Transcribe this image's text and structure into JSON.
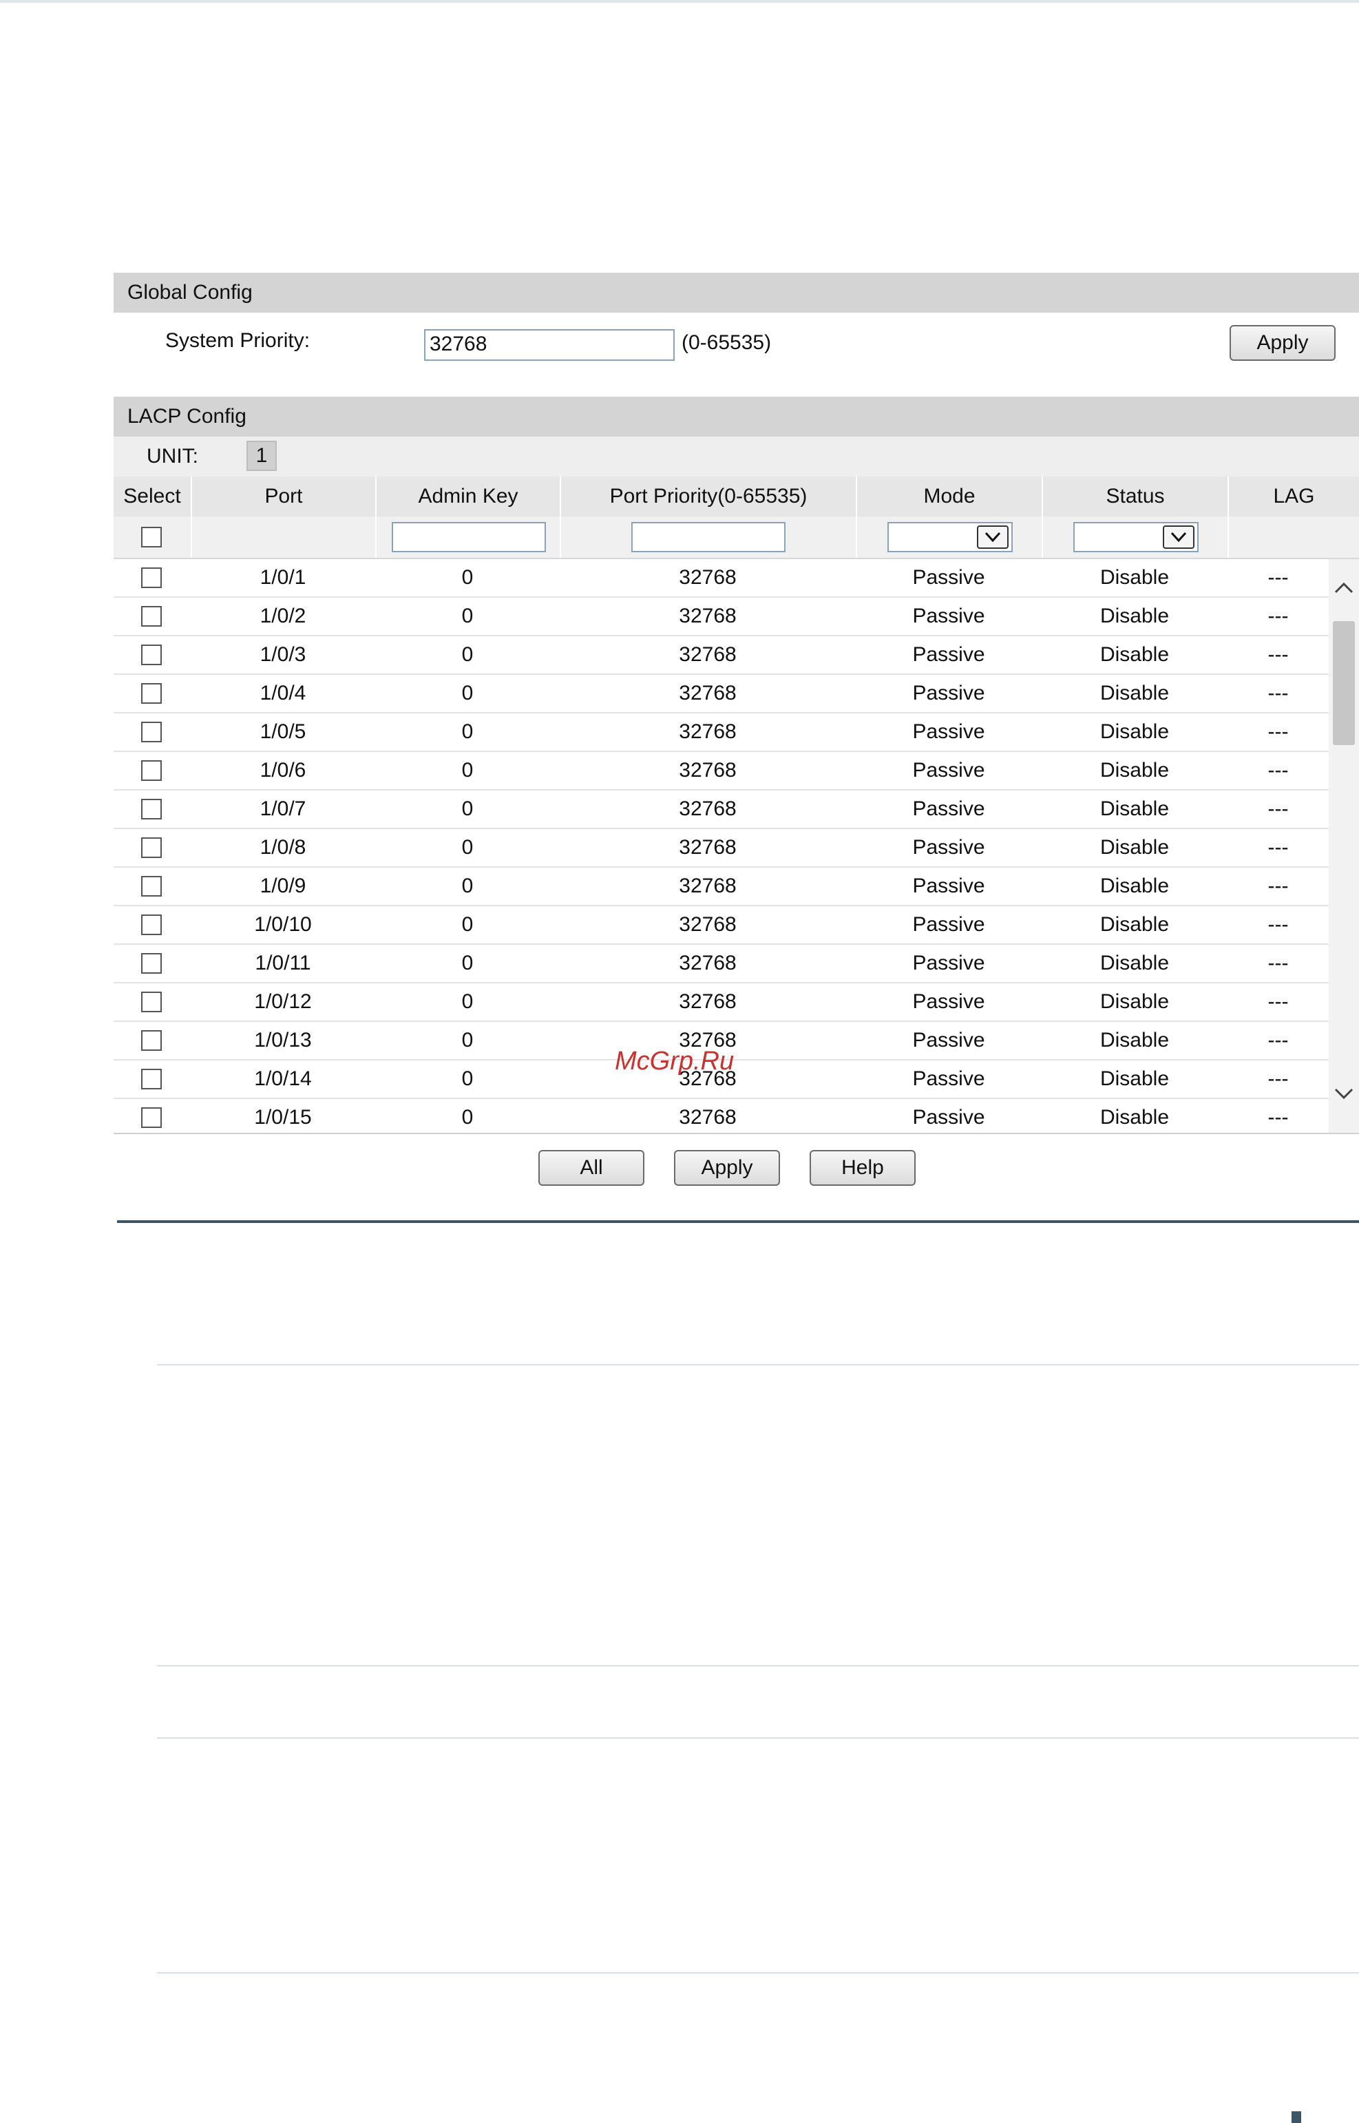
{
  "global_config": {
    "title": "Global Config",
    "system_priority_label": "System Priority:",
    "system_priority_value": "32768",
    "range_hint": "(0-65535)",
    "apply_label": "Apply"
  },
  "lacp_config": {
    "title": "LACP Config",
    "unit_label": "UNIT:",
    "unit_value": "1",
    "columns": [
      "Select",
      "Port",
      "Admin Key",
      "Port Priority(0-65535)",
      "Mode",
      "Status",
      "LAG"
    ],
    "rows": [
      {
        "port": "1/0/1",
        "admin_key": "0",
        "priority": "32768",
        "mode": "Passive",
        "status": "Disable",
        "lag": "---"
      },
      {
        "port": "1/0/2",
        "admin_key": "0",
        "priority": "32768",
        "mode": "Passive",
        "status": "Disable",
        "lag": "---"
      },
      {
        "port": "1/0/3",
        "admin_key": "0",
        "priority": "32768",
        "mode": "Passive",
        "status": "Disable",
        "lag": "---"
      },
      {
        "port": "1/0/4",
        "admin_key": "0",
        "priority": "32768",
        "mode": "Passive",
        "status": "Disable",
        "lag": "---"
      },
      {
        "port": "1/0/5",
        "admin_key": "0",
        "priority": "32768",
        "mode": "Passive",
        "status": "Disable",
        "lag": "---"
      },
      {
        "port": "1/0/6",
        "admin_key": "0",
        "priority": "32768",
        "mode": "Passive",
        "status": "Disable",
        "lag": "---"
      },
      {
        "port": "1/0/7",
        "admin_key": "0",
        "priority": "32768",
        "mode": "Passive",
        "status": "Disable",
        "lag": "---"
      },
      {
        "port": "1/0/8",
        "admin_key": "0",
        "priority": "32768",
        "mode": "Passive",
        "status": "Disable",
        "lag": "---"
      },
      {
        "port": "1/0/9",
        "admin_key": "0",
        "priority": "32768",
        "mode": "Passive",
        "status": "Disable",
        "lag": "---"
      },
      {
        "port": "1/0/10",
        "admin_key": "0",
        "priority": "32768",
        "mode": "Passive",
        "status": "Disable",
        "lag": "---"
      },
      {
        "port": "1/0/11",
        "admin_key": "0",
        "priority": "32768",
        "mode": "Passive",
        "status": "Disable",
        "lag": "---"
      },
      {
        "port": "1/0/12",
        "admin_key": "0",
        "priority": "32768",
        "mode": "Passive",
        "status": "Disable",
        "lag": "---"
      },
      {
        "port": "1/0/13",
        "admin_key": "0",
        "priority": "32768",
        "mode": "Passive",
        "status": "Disable",
        "lag": "---"
      },
      {
        "port": "1/0/14",
        "admin_key": "0",
        "priority": "32768",
        "mode": "Passive",
        "status": "Disable",
        "lag": "---"
      },
      {
        "port": "1/0/15",
        "admin_key": "0",
        "priority": "32768",
        "mode": "Passive",
        "status": "Disable",
        "lag": "---"
      }
    ]
  },
  "buttons": {
    "all": "All",
    "apply": "Apply",
    "help": "Help"
  },
  "watermark": "McGrp.Ru"
}
